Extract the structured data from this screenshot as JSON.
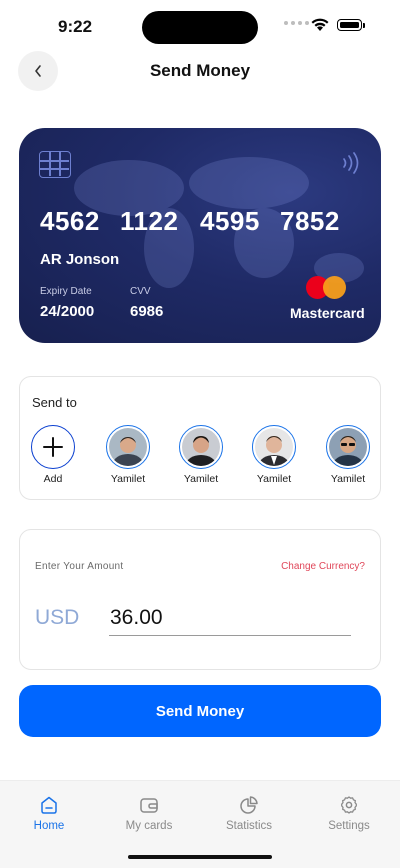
{
  "status_bar": {
    "time": "9:22"
  },
  "header": {
    "title": "Send Money"
  },
  "card": {
    "number_groups": [
      "4562",
      "1122",
      "4595",
      "7852"
    ],
    "holder": "AR Jonson",
    "expiry_label": "Expiry Date",
    "expiry_value": "24/2000",
    "cvv_label": "CVV",
    "cvv_value": "6986",
    "brand": "Mastercard"
  },
  "send_to": {
    "title": "Send to",
    "add_label": "Add",
    "contacts": [
      {
        "name": "Yamilet"
      },
      {
        "name": "Yamilet"
      },
      {
        "name": "Yamilet"
      },
      {
        "name": "Yamilet"
      }
    ]
  },
  "amount": {
    "label": "Enter Your Amount",
    "change_currency": "Change Currency?",
    "currency": "USD",
    "value": "36.00"
  },
  "send_button": "Send Money",
  "tabs": [
    {
      "label": "Home",
      "icon": "home-icon",
      "active": true
    },
    {
      "label": "My cards",
      "icon": "wallet-icon",
      "active": false
    },
    {
      "label": "Statistics",
      "icon": "pie-chart-icon",
      "active": false
    },
    {
      "label": "Settings",
      "icon": "gear-icon",
      "active": false
    }
  ],
  "colors": {
    "accent": "#0066ff",
    "card_bg": "#1f2a66",
    "link_red": "#e0475a",
    "currency_text": "#8fa9d6"
  }
}
